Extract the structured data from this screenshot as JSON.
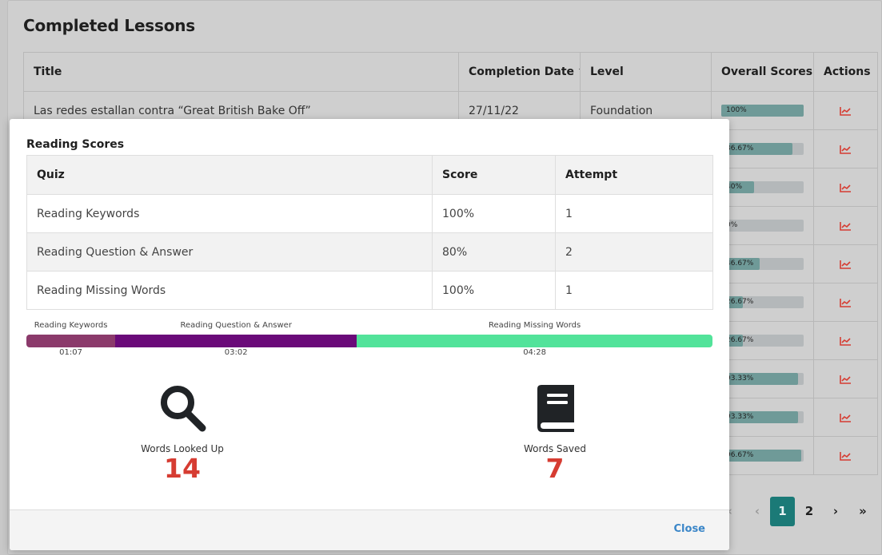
{
  "page": {
    "title": "Completed Lessons",
    "columns": [
      "Title",
      "Completion Date",
      "Level",
      "Overall Scores",
      "Actions"
    ],
    "rows": [
      {
        "title": "Las redes estallan contra “Great British Bake Off”",
        "date": "27/11/22",
        "level": "Foundation",
        "score_label": "100%",
        "score": 1.0
      },
      {
        "title": "",
        "date": "",
        "level": "",
        "score_label": "86.67%",
        "score": 0.8667
      },
      {
        "title": "",
        "date": "",
        "level": "",
        "score_label": "40%",
        "score": 0.4
      },
      {
        "title": "",
        "date": "",
        "level": "",
        "score_label": "0%",
        "score": 0.0
      },
      {
        "title": "",
        "date": "",
        "level": "",
        "score_label": "46.67%",
        "score": 0.4667
      },
      {
        "title": "",
        "date": "",
        "level": "",
        "score_label": "26.67%",
        "score": 0.2667
      },
      {
        "title": "",
        "date": "",
        "level": "",
        "score_label": "26.67%",
        "score": 0.2667
      },
      {
        "title": "",
        "date": "",
        "level": "",
        "score_label": "93.33%",
        "score": 0.9333
      },
      {
        "title": "",
        "date": "",
        "level": "",
        "score_label": "93.33%",
        "score": 0.9333
      },
      {
        "title": "",
        "date": "",
        "level": "",
        "score_label": "96.67%",
        "score": 0.9667
      }
    ],
    "action_icon": "trend-chart-icon",
    "pagination": {
      "first": "«",
      "prev": "‹",
      "pages": [
        "1",
        "2"
      ],
      "active": "1",
      "next": "›",
      "last": "»"
    }
  },
  "modal": {
    "heading": "Reading Scores",
    "columns": {
      "quiz": "Quiz",
      "score": "Score",
      "attempt": "Attempt"
    },
    "rows": [
      {
        "quiz": "Reading Keywords",
        "score": "100%",
        "attempt": "1"
      },
      {
        "quiz": "Reading Question & Answer",
        "score": "80%",
        "attempt": "2"
      },
      {
        "quiz": "Reading Missing Words",
        "score": "100%",
        "attempt": "1"
      }
    ],
    "timeline": [
      {
        "label": "Reading Keywords",
        "time": "01:07",
        "seconds": 67,
        "color": "#8b3a6b"
      },
      {
        "label": "Reading Question & Answer",
        "time": "03:02",
        "seconds": 182,
        "color": "#6a0a79"
      },
      {
        "label": "Reading Missing Words",
        "time": "04:28",
        "seconds": 268,
        "color": "#52e39a"
      }
    ],
    "stats": [
      {
        "label": "Words Looked Up",
        "value": "14",
        "icon": "search-icon"
      },
      {
        "label": "Words Saved",
        "value": "7",
        "icon": "book-icon"
      }
    ],
    "close_label": "Close"
  },
  "colors": {
    "accent": "#1b7a77",
    "bar_fill": "#6f9a98",
    "stat_value": "#d63c32",
    "close_link": "#3a86c8",
    "trend_icon": "#d63c32"
  }
}
